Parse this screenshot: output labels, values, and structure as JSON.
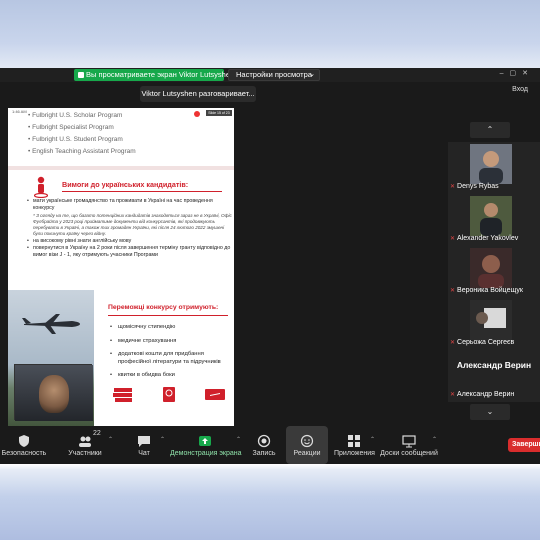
{
  "topbar": {
    "share_banner": "Вы просматриваете экран Viktor Lutsyshen",
    "view_options": "Настройки просмотра",
    "exit_label": "Вход",
    "tooltip": "Viktor Lutsyshen разговаривает..."
  },
  "slide": {
    "phone_time": "1:46 AM",
    "phone_badge": "Slide 15 of 23",
    "programs": [
      "Fulbright U.S. Scholar Program",
      "Fulbright Specialist Program",
      "Fulbright U.S. Student Program",
      "English Teaching Assistant Program"
    ],
    "requirements_title": "Вимоги до українських кандидатів:",
    "requirements": [
      "мати українське громадянство та проживати в Україні на час проведення конкурсу",
      "* З огляду на те, що багато потенційних кандидатів знаходяться зараз не в Україні, Офіс Фулбрайта у 2023 році прийматиме документи від конкурсантів, які продовжують перебувати в Україні, а також тих громадян України, які після 24 лютого 2022 змушені були покинути країну через війну.",
      "на високому рівні знати англійську мову",
      "повернутися в Україну на 2 роки після завершення терміну гранту відповідно до вимог візи J - 1, яку отримують учасники Програми"
    ],
    "winners_title": "Переможці конкурсу отримують:",
    "benefits": [
      "щомісячну стипендію",
      "медичне страхування",
      "додаткові кошти для придбання професійної літератури та підручників",
      "квитки в обидва боки"
    ]
  },
  "participants": [
    {
      "name": "Denys Rybas",
      "muted": true
    },
    {
      "name": "Alexander Yakovlev",
      "muted": true
    },
    {
      "name": "Вероника Войцещук",
      "muted": true
    },
    {
      "name": "Серьожа Сергеєв",
      "muted": true
    },
    {
      "name": "Александр Верин",
      "muted": true,
      "video_off_label": "Александр Верин"
    }
  ],
  "toolbar": {
    "security": "Безопасность",
    "participants": "Участники",
    "participants_count": "22",
    "chat": "Чат",
    "share": "Демонстрация экрана",
    "record": "Запись",
    "reactions": "Реакции",
    "apps": "Приложения",
    "whiteboard": "Доски сообщений",
    "end": "Завершить"
  },
  "colors": {
    "zoom_bg": "#1a1a1a",
    "share_green": "#17a84b",
    "accent_red": "#d0202b",
    "end_red": "#d92d2d"
  }
}
